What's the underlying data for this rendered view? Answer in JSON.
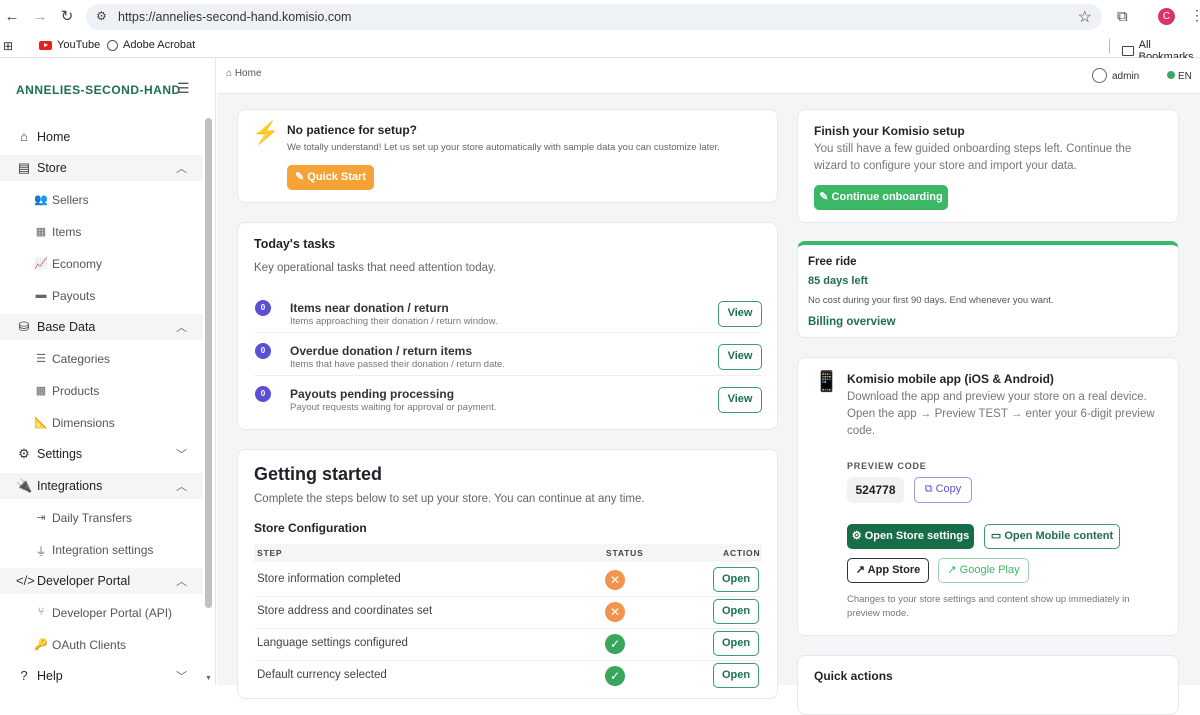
{
  "browser": {
    "url": "https://annelies-second-hand.komisio.com",
    "profile_initial": "C",
    "bookmarks": [
      {
        "label": "YouTube",
        "icon": "youtube-icon"
      },
      {
        "label": "Adobe Acrobat",
        "icon": "acrobat-icon"
      }
    ],
    "all_bookmarks": "All Bookmarks"
  },
  "sidebar": {
    "brand": "ANNELIES-SECOND-HAND",
    "home": "Home",
    "store": {
      "label": "Store",
      "items": [
        "Sellers",
        "Items",
        "Economy",
        "Payouts"
      ]
    },
    "base_data": {
      "label": "Base Data",
      "items": [
        "Categories",
        "Products",
        "Dimensions"
      ]
    },
    "settings": "Settings",
    "integrations": {
      "label": "Integrations",
      "items": [
        "Daily Transfers",
        "Integration settings"
      ]
    },
    "developer_portal": {
      "label": "Developer Portal",
      "items": [
        "Developer Portal (API)",
        "OAuth Clients"
      ]
    },
    "help": "Help"
  },
  "topbar": {
    "breadcrumb": "Home",
    "user": "admin",
    "language": "EN"
  },
  "quick_setup": {
    "title": "No patience for setup?",
    "text": "We totally understand! Let us set up your store automatically with sample data you can customize later.",
    "button": "Quick Start"
  },
  "tasks": {
    "title": "Today's tasks",
    "subtitle": "Key operational tasks that need attention today.",
    "view_label": "View",
    "items": [
      {
        "count": "0",
        "title": "Items near donation / return",
        "desc": "Items approaching their donation / return window."
      },
      {
        "count": "0",
        "title": "Overdue donation / return items",
        "desc": "Items that have passed their donation / return date."
      },
      {
        "count": "0",
        "title": "Payouts pending processing",
        "desc": "Payout requests waiting for approval or payment."
      }
    ]
  },
  "getting_started": {
    "title": "Getting started",
    "subtitle": "Complete the steps below to set up your store. You can continue at any time.",
    "section": "Store Configuration",
    "columns": [
      "STEP",
      "STATUS",
      "ACTION"
    ],
    "open_label": "Open",
    "rows": [
      {
        "step": "Store information completed",
        "status": "pending"
      },
      {
        "step": "Store address and coordinates set",
        "status": "pending"
      },
      {
        "step": "Language settings configured",
        "status": "done"
      },
      {
        "step": "Default currency selected",
        "status": "done"
      }
    ]
  },
  "finish_setup": {
    "title": "Finish your Komisio setup",
    "text_1": "You still have a few guided onboarding steps left. Continue the",
    "text_2": "wizard to configure your store and import your data.",
    "button": "Continue onboarding"
  },
  "plan": {
    "title": "Free ride",
    "days_left": "85 days left",
    "text": "No cost during your first 90 days. End whenever you want.",
    "link": "Billing overview",
    "accent": "#3cb766"
  },
  "mobile_app": {
    "title": "Komisio mobile app (iOS & Android)",
    "text_1": "Download the app and preview your store on a real device.",
    "text_2": "Open the app → Preview TEST → enter your 6-digit preview",
    "text_3": "code.",
    "code_label": "PREVIEW CODE",
    "code": "524778",
    "copy": "Copy",
    "open_settings": "Open Store settings",
    "open_content": "Open Mobile content",
    "app_store": "App Store",
    "google_play": "Google Play",
    "note_1": "Changes to your store settings and content show up immediately in",
    "note_2": "preview mode."
  },
  "quick_actions": {
    "title": "Quick actions"
  }
}
